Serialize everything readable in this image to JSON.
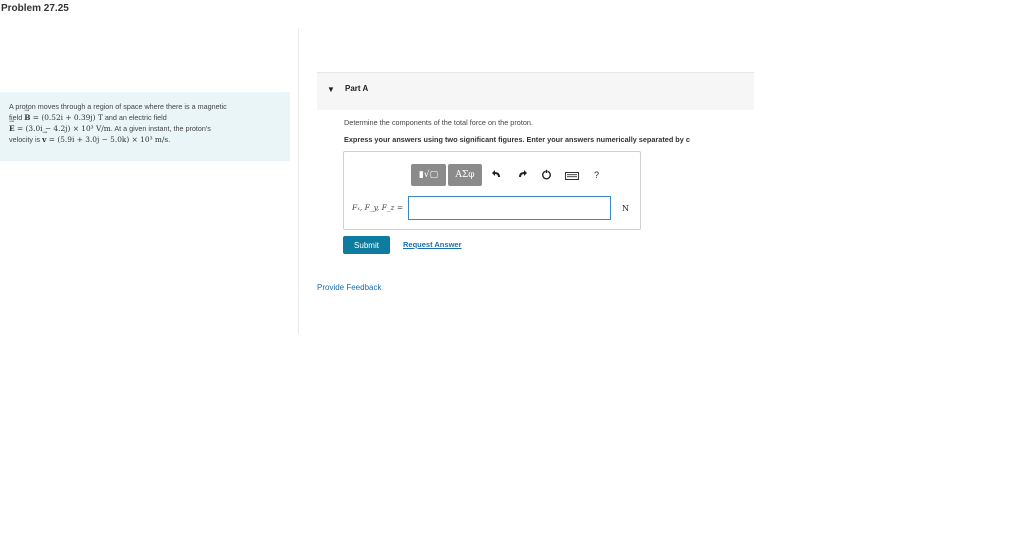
{
  "header": {
    "title": "Problem 27.25"
  },
  "problem": {
    "line1": "A proton moves through a region of space where there is a magnetic",
    "line2_prefix": "field ",
    "B_sym": "B",
    "B_expr": " = (0.52i + 0.39j) T",
    "line2_suffix": " and an electric field",
    "E_sym": "E",
    "E_expr": " = (3.0i − 4.2j) × 10³ V/m",
    "line3_suffix": ". At a given instant, the proton's",
    "line4_prefix": "velocity is ",
    "v_sym": "v",
    "v_expr": " = (5.9i + 3.0j − 5.0k) × 10³ m/s",
    "line4_suffix": "."
  },
  "part": {
    "caret": "▼",
    "label": "Part A",
    "instruction": "Determine the components of the total force on the proton.",
    "emphasis": "Express your answers using two significant figures. Enter your answers numerically separated by c"
  },
  "answer": {
    "toolbar": {
      "template_label": "▮√▢",
      "symbols_label": "ΑΣφ",
      "undo_icon": "undo-icon",
      "redo_icon": "redo-icon",
      "reset_icon": "reset-icon",
      "keyboard_icon": "keyboard-icon",
      "help_label": "?"
    },
    "variables_label": "F",
    "variables_full": "Fₓ, F_y, F_z =",
    "input_value": "",
    "unit": "N"
  },
  "actions": {
    "submit_label": "Submit",
    "request_answer_label": "Request Answer",
    "feedback_label": "Provide Feedback"
  },
  "colors": {
    "submit": "#0e7c9f",
    "link": "#1a6fb0",
    "problem_bg": "#e9f5f7",
    "input_border": "#3a86c8"
  }
}
